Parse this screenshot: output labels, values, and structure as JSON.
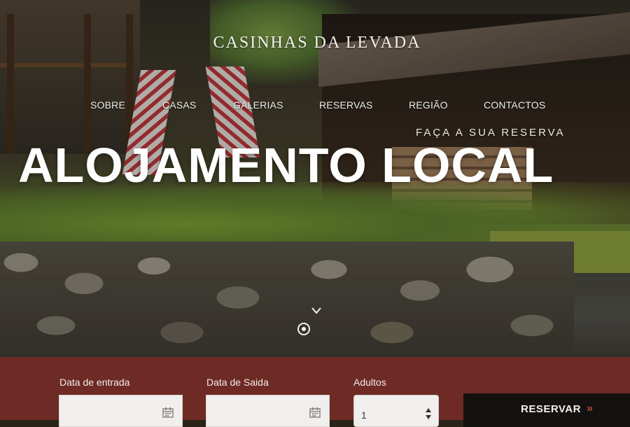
{
  "header": {
    "site_title": "CASINHAS DA LEVADA"
  },
  "nav": {
    "items": [
      {
        "label": "SOBRE"
      },
      {
        "label": "CASAS"
      },
      {
        "label": "GALERIAS"
      },
      {
        "label": "RESERVAS"
      },
      {
        "label": "REGIÃO"
      },
      {
        "label": "CONTACTOS"
      }
    ]
  },
  "hero": {
    "tagline": "FAÇA A SUA RESERVA",
    "headline": "ALOJAMENTO LOCAL",
    "icons": {
      "scroll": "chevron-down-icon",
      "indicator": "scroll-indicator-icon"
    }
  },
  "booking": {
    "checkin_label": "Data de entrada",
    "checkin_value": "",
    "checkout_label": "Data de Saida",
    "checkout_value": "",
    "adults_label": "Adultos",
    "adults_value": "1",
    "reserve_label": "RESERVAR",
    "reserve_arrow": "»",
    "colors": {
      "bar": "#6e2a24",
      "button": "#141210",
      "arrow": "#b94a3c"
    }
  }
}
